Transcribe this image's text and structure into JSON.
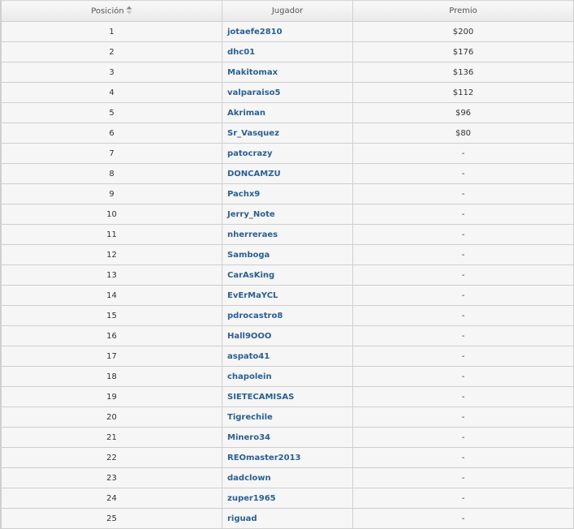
{
  "table": {
    "headers": {
      "position": "Posición",
      "player": "Jugador",
      "prize": "Premio"
    },
    "rows": [
      {
        "position": "1",
        "player": "jotaefe2810",
        "prize": "$200"
      },
      {
        "position": "2",
        "player": "dhc01",
        "prize": "$176"
      },
      {
        "position": "3",
        "player": "Makitomax",
        "prize": "$136"
      },
      {
        "position": "4",
        "player": "valparaiso5",
        "prize": "$112"
      },
      {
        "position": "5",
        "player": "Akriman",
        "prize": "$96"
      },
      {
        "position": "6",
        "player": "Sr_Vasquez",
        "prize": "$80"
      },
      {
        "position": "7",
        "player": "patocrazy",
        "prize": "-"
      },
      {
        "position": "8",
        "player": "DONCAMZU",
        "prize": "-"
      },
      {
        "position": "9",
        "player": "Pachx9",
        "prize": "-"
      },
      {
        "position": "10",
        "player": "Jerry_Note",
        "prize": "-"
      },
      {
        "position": "11",
        "player": "nherreraes",
        "prize": "-"
      },
      {
        "position": "12",
        "player": "Samboga",
        "prize": "-"
      },
      {
        "position": "13",
        "player": "CarAsKing",
        "prize": "-"
      },
      {
        "position": "14",
        "player": "EvErMaYCL",
        "prize": "-"
      },
      {
        "position": "15",
        "player": "pdrocastro8",
        "prize": "-"
      },
      {
        "position": "16",
        "player": "Hall9OOO",
        "prize": "-"
      },
      {
        "position": "17",
        "player": "aspato41",
        "prize": "-"
      },
      {
        "position": "18",
        "player": "chapolein",
        "prize": "-"
      },
      {
        "position": "19",
        "player": "SIETECAMISAS",
        "prize": "-"
      },
      {
        "position": "20",
        "player": "Tigrechile",
        "prize": "-"
      },
      {
        "position": "21",
        "player": "Minero34",
        "prize": "-"
      },
      {
        "position": "22",
        "player": "REOmaster2013",
        "prize": "-"
      },
      {
        "position": "23",
        "player": "dadclown",
        "prize": "-"
      },
      {
        "position": "24",
        "player": "zuper1965",
        "prize": "-"
      },
      {
        "position": "25",
        "player": "riguad",
        "prize": "-"
      }
    ]
  },
  "icons": {
    "sort": "sort-arrows-icon"
  },
  "colors": {
    "link": "#2a5f92",
    "row_bg": "#f6f6f6",
    "border": "#cfcfcf"
  }
}
